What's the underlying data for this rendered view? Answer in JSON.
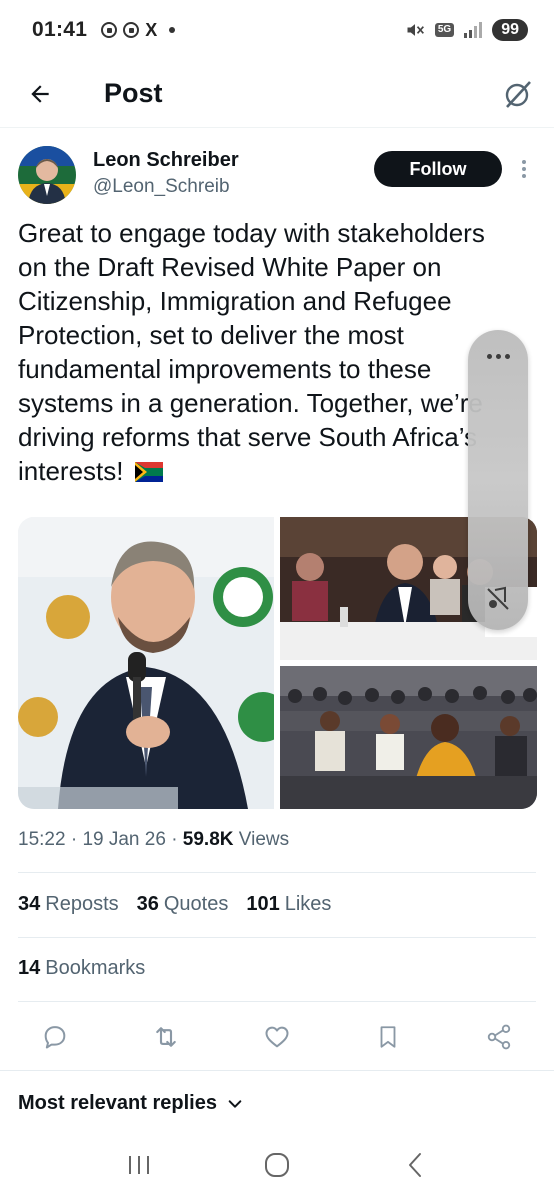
{
  "status_bar": {
    "time": "01:41",
    "x_label": "X",
    "network": "5G",
    "battery": "99"
  },
  "header": {
    "title": "Post"
  },
  "post": {
    "author_name": "Leon Schreiber",
    "author_handle": "@Leon_Schreib",
    "follow_label": "Follow",
    "text": "Great to engage today with stakeholders on the Draft Revised White Paper on Citizenship, Immigration and Refugee Protection, set to deliver the most fundamental improvements to these systems in a generation. Together, we’re driving reforms that serve South Africa’s interests!",
    "time": "15:22",
    "date": "19 Jan 26",
    "views_count": "59.8K",
    "views_label": "Views",
    "separator": "·"
  },
  "stats": {
    "reposts_count": "34",
    "reposts_label": "Reposts",
    "quotes_count": "36",
    "quotes_label": "Quotes",
    "likes_count": "101",
    "likes_label": "Likes",
    "bookmarks_count": "14",
    "bookmarks_label": "Bookmarks"
  },
  "replies": {
    "sort_label": "Most relevant replies"
  },
  "icons": {
    "back": "arrow-left-icon",
    "grok": "grok-icon",
    "more": "more-vertical-icon",
    "reply": "reply-icon",
    "repost": "repost-icon",
    "like": "heart-icon",
    "bookmark": "bookmark-icon",
    "share": "share-icon"
  },
  "colors": {
    "text_primary": "#0f1419",
    "text_secondary": "#536471",
    "follow_bg": "#0f1419",
    "divider": "#e6ecf0"
  }
}
